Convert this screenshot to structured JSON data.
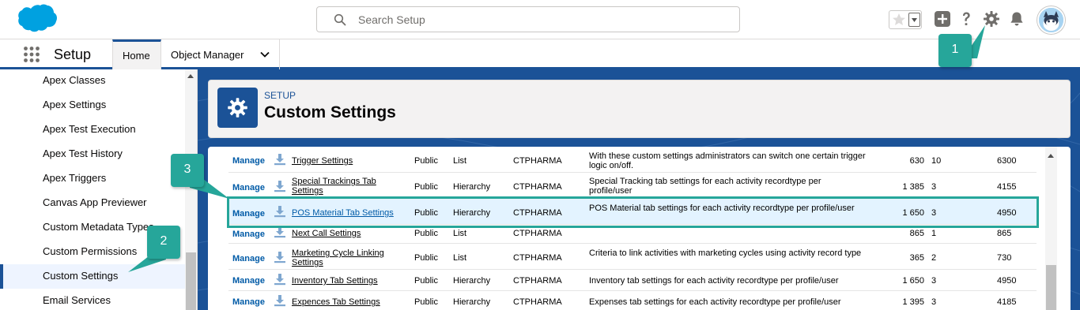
{
  "header": {
    "search_placeholder": "Search Setup",
    "icons": [
      "salesforce-cloud-logo",
      "star-icon",
      "chevron-down-icon",
      "add-icon",
      "help-icon",
      "gear-icon",
      "bell-icon",
      "avatar"
    ]
  },
  "app_bar": {
    "app_name": "Setup",
    "tabs": [
      {
        "label": "Home",
        "selected": true
      },
      {
        "label": "Object Manager",
        "selected": false
      }
    ]
  },
  "sidebar": {
    "items": [
      {
        "label": "Apex Classes"
      },
      {
        "label": "Apex Settings"
      },
      {
        "label": "Apex Test Execution"
      },
      {
        "label": "Apex Test History"
      },
      {
        "label": "Apex Triggers"
      },
      {
        "label": "Canvas App Previewer"
      },
      {
        "label": "Custom Metadata Types"
      },
      {
        "label": "Custom Permissions"
      },
      {
        "label": "Custom Settings",
        "selected": true
      },
      {
        "label": "Email Services"
      }
    ]
  },
  "page_header": {
    "eyebrow": "SETUP",
    "title": "Custom Settings"
  },
  "table": {
    "manage_label": "Manage",
    "rows": [
      {
        "name": "Trigger Settings",
        "visibility": "Public",
        "type": "List",
        "namespace": "CTPHARMA",
        "description": "With these custom settings administrators can switch one certain trigger logic on/off.",
        "size": "630",
        "records": "10",
        "total": "6300"
      },
      {
        "name": "Special Trackings Tab Settings",
        "visibility": "Public",
        "type": "Hierarchy",
        "namespace": "CTPHARMA",
        "description": "Special Tracking tab settings for each activity recordtype per profile/user",
        "size": "1 385",
        "records": "3",
        "total": "4155"
      },
      {
        "name": "POS Material Tab Settings",
        "visibility": "Public",
        "type": "Hierarchy",
        "namespace": "CTPHARMA",
        "description": "POS Material tab settings for each activity recordtype per profile/user",
        "size": "1 650",
        "records": "3",
        "total": "4950",
        "highlighted": true
      },
      {
        "name": "Next Call Settings",
        "visibility": "Public",
        "type": "List",
        "namespace": "CTPHARMA",
        "description": "",
        "size": "865",
        "records": "1",
        "total": "865"
      },
      {
        "name": "Marketing Cycle Linking Settings",
        "visibility": "Public",
        "type": "List",
        "namespace": "CTPHARMA",
        "description": "Criteria to link activities with marketing cycles using activity record type",
        "size": "365",
        "records": "2",
        "total": "730"
      },
      {
        "name": "Inventory Tab Settings",
        "visibility": "Public",
        "type": "Hierarchy",
        "namespace": "CTPHARMA",
        "description": "Inventory tab settings for each activity recordtype per profile/user",
        "size": "1 650",
        "records": "3",
        "total": "4950"
      },
      {
        "name": "Expences Tab Settings",
        "visibility": "Public",
        "type": "Hierarchy",
        "namespace": "CTPHARMA",
        "description": "Expenses tab settings for each activity recordtype per profile/user",
        "size": "1 395",
        "records": "3",
        "total": "4185"
      }
    ]
  },
  "callouts": [
    {
      "label": "1"
    },
    {
      "label": "2"
    },
    {
      "label": "3"
    }
  ],
  "colors": {
    "brand": "#1b5297",
    "callout": "#26a69a",
    "link": "#015ba7",
    "highlight_row": "#e3f3ff"
  }
}
